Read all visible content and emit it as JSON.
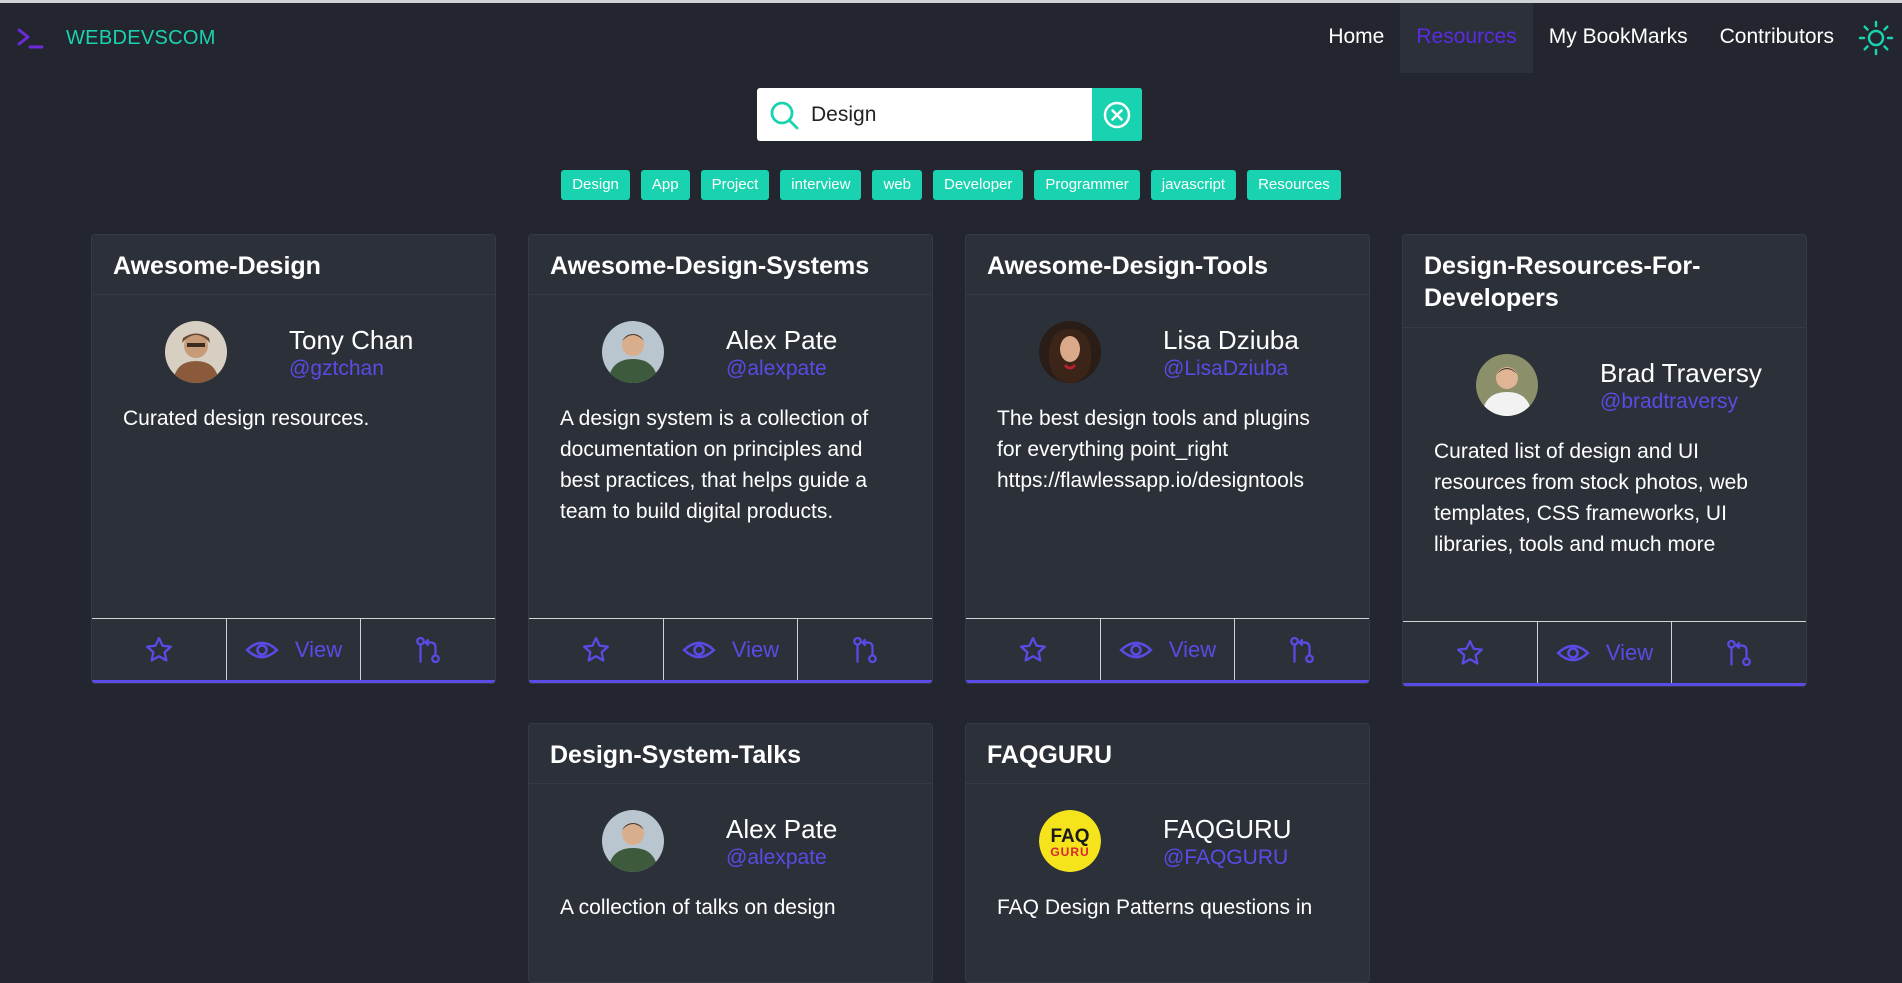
{
  "brand": {
    "name": "WEBDEVSCOM",
    "icon": "terminal-icon"
  },
  "nav": {
    "links": [
      {
        "label": "Home"
      },
      {
        "label": "Resources",
        "active": true
      },
      {
        "label": "My BookMarks"
      },
      {
        "label": "Contributors"
      }
    ],
    "theme_icon": "sun-icon"
  },
  "search": {
    "value": "Design",
    "icon": "search-icon",
    "clear_icon": "close-circle-icon"
  },
  "tags": [
    "Design",
    "App",
    "Project",
    "interview",
    "web",
    "Developer",
    "Programmer",
    "javascript",
    "Resources"
  ],
  "colors": {
    "background": "#23262e",
    "card": "#2c3038",
    "accent": "#19d3b0",
    "link": "#5b4be6",
    "active_nav": "#5b2be3"
  },
  "cards": [
    {
      "title": "Awesome-Design",
      "author": "Tony Chan",
      "handle": "@gztchan",
      "description": "Curated design resources.",
      "view_label": "View"
    },
    {
      "title": "Awesome-Design-Systems",
      "author": "Alex Pate",
      "handle": "@alexpate",
      "description": "A design system is a collection of documentation on principles and best practices, that helps guide a team to build digital products.",
      "view_label": "View"
    },
    {
      "title": "Awesome-Design-Tools",
      "author": "Lisa Dziuba",
      "handle": "@LisaDziuba",
      "description": "The best design tools and plugins for everything point_right https://flawlessapp.io/designtools",
      "view_label": "View"
    },
    {
      "title": "Design-Resources-For-Developers",
      "author": "Brad Traversy",
      "handle": "@bradtraversy",
      "description": "Curated list of design and UI resources from stock photos, web templates, CSS frameworks, UI libraries, tools and much more",
      "view_label": "View"
    },
    {
      "title": "Design-System-Talks",
      "author": "Alex Pate",
      "handle": "@alexpate",
      "description": "A collection of talks on design"
    },
    {
      "title": "FAQGURU",
      "author": "FAQGURU",
      "handle": "@FAQGURU",
      "description": "FAQ Design Patterns questions in",
      "logo_text_top": "FAQ",
      "logo_text_bottom": "GURU"
    }
  ]
}
